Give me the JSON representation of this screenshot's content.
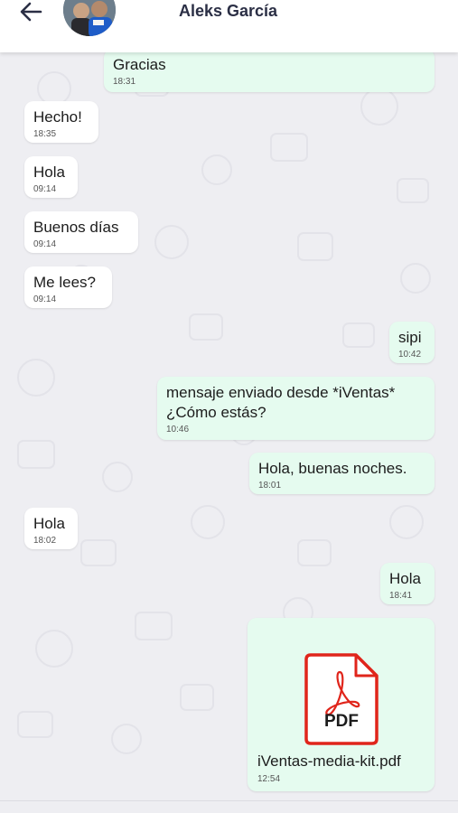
{
  "header": {
    "contact_name": "Aleks García"
  },
  "messages": [
    {
      "dir": "out",
      "text": "Gracias",
      "time": "18:31"
    },
    {
      "dir": "in",
      "text": "Hecho!",
      "time": "18:35"
    },
    {
      "dir": "in",
      "text": "Hola",
      "time": "09:14"
    },
    {
      "dir": "in",
      "text": "Buenos días",
      "time": "09:14"
    },
    {
      "dir": "in",
      "text": "Me lees?",
      "time": "09:14"
    },
    {
      "dir": "out",
      "text": "sipi",
      "time": "10:42"
    },
    {
      "dir": "out",
      "text_line1": "mensaje enviado desde *iVentas*",
      "text_line2": "¿Cómo estás?",
      "time": "10:46"
    },
    {
      "dir": "out",
      "text": "Hola, buenas noches.",
      "time": "18:01"
    },
    {
      "dir": "in",
      "text": "Hola",
      "time": "18:02"
    },
    {
      "dir": "out",
      "text": "Hola",
      "time": "18:41"
    },
    {
      "dir": "out",
      "type": "file",
      "file_label": "PDF",
      "file_name": "iVentas-media-kit.pdf",
      "time": "12:54"
    }
  ],
  "colors": {
    "incoming_bubble": "#ffffff",
    "outgoing_bubble": "#e5fbef",
    "pdf_red": "#e0251b",
    "chat_background": "#eeeef2"
  },
  "icons": {
    "back": "arrow-left-icon",
    "file": "pdf-file-icon"
  }
}
